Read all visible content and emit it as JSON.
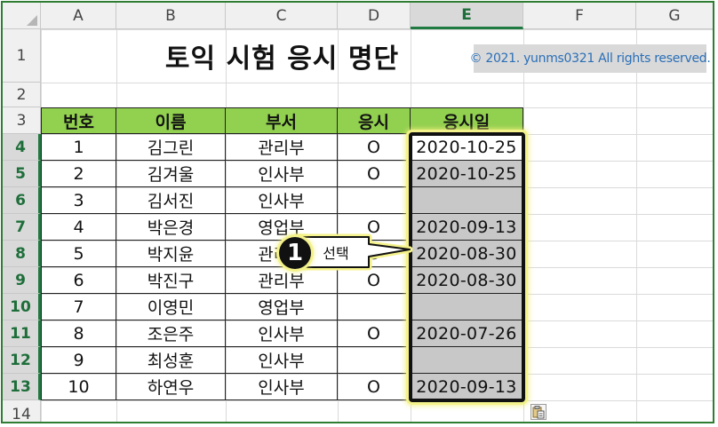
{
  "columns": [
    "A",
    "B",
    "C",
    "D",
    "E",
    "F",
    "G"
  ],
  "selected_column": "E",
  "rows": [
    "1",
    "2",
    "3",
    "4",
    "5",
    "6",
    "7",
    "8",
    "9",
    "10",
    "11",
    "12",
    "13",
    "14"
  ],
  "selected_rows": [
    "4",
    "5",
    "6",
    "7",
    "8",
    "9",
    "10",
    "11",
    "12",
    "13"
  ],
  "title": "토익 시험 응시 명단",
  "copyright": "© 2021. yunms0321 All rights reserved.",
  "table": {
    "headers": [
      "번호",
      "이름",
      "부서",
      "응시",
      "응시일"
    ],
    "rows": [
      [
        "1",
        "김그린",
        "관리부",
        "O",
        "2020-10-25"
      ],
      [
        "2",
        "김겨울",
        "인사부",
        "O",
        "2020-10-25"
      ],
      [
        "3",
        "김서진",
        "인사부",
        "",
        ""
      ],
      [
        "4",
        "박은경",
        "영업부",
        "O",
        "2020-09-13"
      ],
      [
        "5",
        "박지윤",
        "관리부",
        "O",
        "2020-08-30"
      ],
      [
        "6",
        "박진구",
        "관리부",
        "O",
        "2020-08-30"
      ],
      [
        "7",
        "이영민",
        "영업부",
        "",
        ""
      ],
      [
        "8",
        "조은주",
        "인사부",
        "O",
        "2020-07-26"
      ],
      [
        "9",
        "최성훈",
        "인사부",
        "",
        ""
      ],
      [
        "10",
        "하연우",
        "인사부",
        "O",
        "2020-09-13"
      ]
    ]
  },
  "callout": {
    "number": "1",
    "label": "선택"
  },
  "icons": {
    "corner": "select-all-triangle-icon",
    "paste": "paste-options-icon"
  },
  "colors": {
    "frame_border": "#2e7d32",
    "header_fill": "#92d050",
    "selection_fill": "#c8c8c8",
    "highlight": "#f4f28a",
    "copyright_text": "#2a6fb7"
  }
}
